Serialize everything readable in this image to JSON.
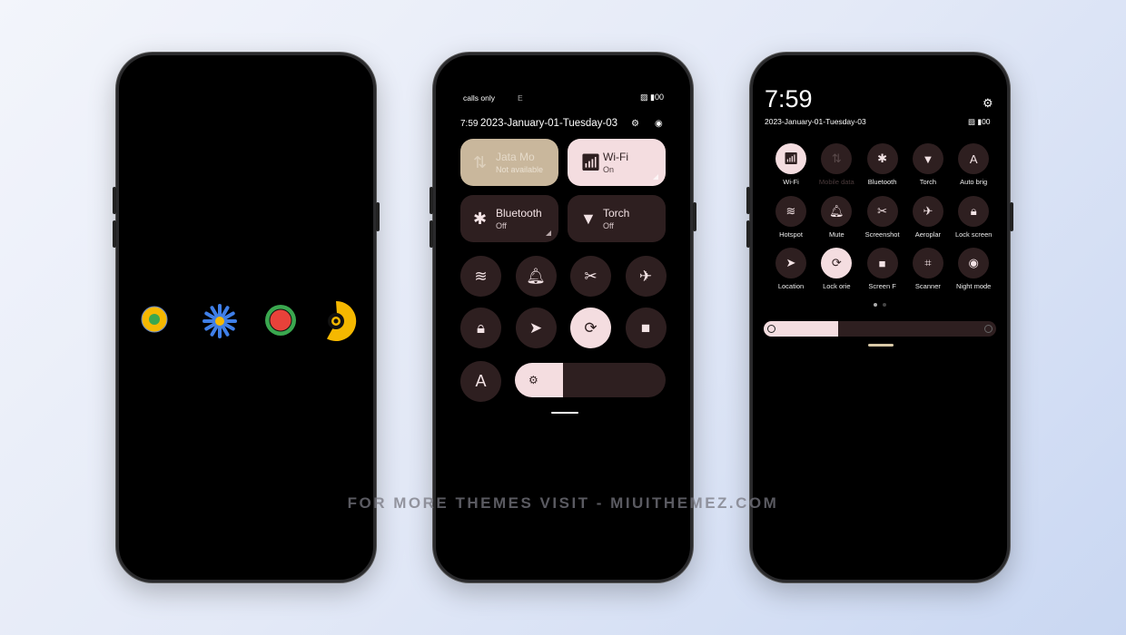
{
  "watermark": "FOR MORE THEMES VISIT - MIUITHEMEZ.COM",
  "colors": {
    "accent": "#f4dde0",
    "tile_dark": "#2e1f20",
    "tile_beige": "#c9b79c"
  },
  "phone1": {
    "icons": [
      "dot-circle-icon",
      "flower-icon",
      "record-icon",
      "camera-lens-icon"
    ]
  },
  "phone2": {
    "status_left": "calls only",
    "status_mid": "E",
    "status_right": "00",
    "time": "7:59",
    "date": "2023-January-01-Tuesday-03",
    "tiles": [
      {
        "title": "Jata     Mo",
        "sub": "Not available",
        "icon": "mobile-data-icon"
      },
      {
        "title": "Wi-Fi",
        "sub": "On",
        "icon": "wifi-icon"
      },
      {
        "title": "Bluetooth",
        "sub": "Off",
        "icon": "bluetooth-icon"
      },
      {
        "title": "Torch",
        "sub": "Off",
        "icon": "torch-icon"
      }
    ],
    "toggles": [
      "hotspot-icon",
      "bell-icon",
      "screenshot-icon",
      "airplane-icon",
      "lock-icon",
      "location-icon",
      "rotation-lock-icon",
      "video-icon"
    ],
    "auto_brightness_glyph": "A",
    "brightness": 0.32
  },
  "phone3": {
    "time": "7:59",
    "date": "2023-January-01-Tuesday-03",
    "battery": "00",
    "toggles": [
      {
        "label": "Wi-Fi",
        "icon": "wifi-icon",
        "on": true
      },
      {
        "label": "Mobile data",
        "icon": "mobile-data-icon",
        "disabled": true
      },
      {
        "label": "Bluetooth",
        "icon": "bluetooth-icon"
      },
      {
        "label": "Torch",
        "icon": "torch-icon"
      },
      {
        "label": "Auto brig",
        "icon": "auto-brightness-icon"
      },
      {
        "label": "Hotspot",
        "icon": "hotspot-icon"
      },
      {
        "label": "Mute",
        "icon": "bell-icon"
      },
      {
        "label": "Screenshot",
        "icon": "screenshot-icon"
      },
      {
        "label": "Aeroplar",
        "icon": "airplane-icon"
      },
      {
        "label": "Lock screen",
        "icon": "lock-icon"
      },
      {
        "label": "Location",
        "icon": "location-icon"
      },
      {
        "label": "Lock orie",
        "icon": "rotation-lock-icon",
        "on": true
      },
      {
        "label": "Screen F",
        "icon": "video-icon"
      },
      {
        "label": "Scanner",
        "icon": "scanner-icon"
      },
      {
        "label": "Night mode",
        "icon": "eye-icon"
      }
    ],
    "page": 1,
    "pages": 2,
    "brightness": 0.32
  }
}
